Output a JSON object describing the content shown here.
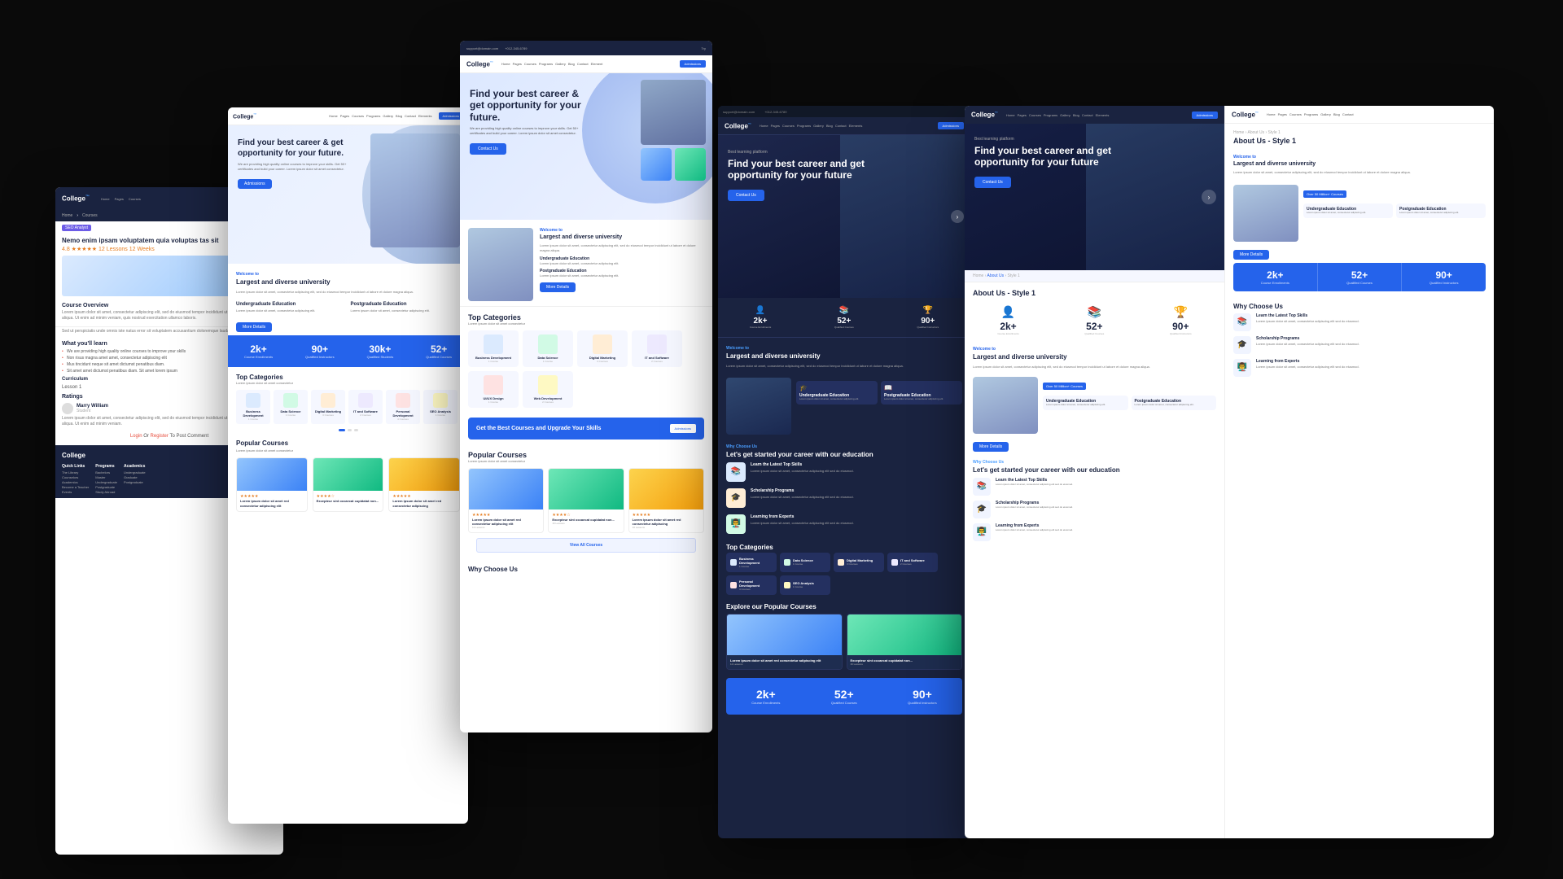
{
  "brand": {
    "name": "College",
    "sup": "™",
    "tagline": "Best learning platform"
  },
  "hero": {
    "title": "Find your best career & get opportunity for your future.",
    "title_dark": "Find your best career and get opportunity for your future",
    "subtitle": "We are providing high quality online courses to improve your skills. Get 50+ certificates and build your career. Lorem ipsum dolor sit amet consectetur.",
    "cta": "Admissions",
    "cta_contact": "Contact Us"
  },
  "nav": {
    "items": [
      "Home",
      "Pages",
      "Courses",
      "Programs",
      "Gallery",
      "Blog",
      "Contact",
      "Elements"
    ],
    "admission_btn": "Admissions"
  },
  "topbar": {
    "email": "support@domain.com",
    "phone": "+012-345-6789",
    "login": "Try"
  },
  "stats": [
    {
      "num": "2k+",
      "label": "Course Enrollments"
    },
    {
      "num": "90+",
      "label": "Qualified Instructors"
    },
    {
      "num": "30k+",
      "label": "Qualified Students"
    },
    {
      "num": "52+",
      "label": "Qualified Courses"
    }
  ],
  "welcome": {
    "label": "Welcome to",
    "title": "Largest and diverse university",
    "text": "Lorem ipsum dolor sit amet, consectetur adipiscing elit, sed do eiusmod tempor incididunt ut labore et dolore magna aliqua.",
    "undergraduate": {
      "title": "Undergraduate Education",
      "text": "Lorem ipsum dolor sit amet, consectetur adipiscing elit."
    },
    "postgraduate": {
      "title": "Postgraduate Education",
      "text": "Lorem ipsum dolor sit amet, consectetur adipiscing elit."
    },
    "more_btn": "More Details"
  },
  "categories": {
    "section_title": "Top Categories",
    "section_sub": "Lorem ipsum dolor sit amet consectetur",
    "items": [
      {
        "name": "Business Development",
        "count": "1 Course",
        "color": "blue"
      },
      {
        "name": "Data Science",
        "count": "1 Course",
        "color": "green"
      },
      {
        "name": "Digital Marketing",
        "count": "3 Courses",
        "color": "orange"
      },
      {
        "name": "IT and Software",
        "count": "2 Courses",
        "color": "purple"
      },
      {
        "name": "Personal Development",
        "count": "4 Courses",
        "color": "red"
      },
      {
        "name": "SEO Analysis",
        "count": "1 Course",
        "color": "yellow"
      }
    ]
  },
  "upgrade": {
    "text": "Get the Best Courses and Upgrade Your Skills",
    "btn": "Admissions"
  },
  "courses": {
    "section_title": "Popular Courses",
    "section_sub": "Lorem ipsum dolor sit amet consectetur",
    "items": [
      {
        "title": "Lorem ipsum dolor sit amet red consectetur adipiscing elit",
        "lessons": "12 Lessons",
        "students": "20 students",
        "color": "blue"
      },
      {
        "title": "Excepteur sint occaecat cupidatat non...",
        "lessons": "16 Lessons",
        "students": "18 students",
        "color": "green"
      },
      {
        "title": "Lorem ipsum dolor sit amet red consectetur adipiscing",
        "lessons": "10 Lessons",
        "students": "15 students",
        "color": "orange"
      }
    ],
    "view_all": "View All Courses"
  },
  "why": {
    "label": "Why Choose Us",
    "title": "Let's get started your career with our education",
    "items": [
      {
        "title": "Learn the Latest Top Skills",
        "text": "Lorem ipsum dolor sit amet, consectetur adipiscing elit sed do eiusmod.",
        "icon": "📚"
      },
      {
        "title": "Scholarship Programs",
        "text": "Lorem ipsum dolor sit amet, consectetur adipiscing elit sed do eiusmod.",
        "icon": "🎓"
      },
      {
        "title": "Learning from Experts",
        "text": "Lorem ipsum dolor sit amet, consectetur adipiscing elit sed do eiusmod.",
        "icon": "👨‍🏫"
      }
    ]
  },
  "about": {
    "breadcrumb": [
      "Home",
      "About Us",
      "Style 1"
    ],
    "title": "About Us - Style 1",
    "page_title": "About Us - Style 1"
  },
  "course_detail": {
    "badge": "SEO Analyst",
    "title": "Nemo enim ipsam voluptatem quia voluptas tas sit",
    "stars": "4.8 ★★★★★ 12 Lessons  12 Weeks",
    "overview_title": "Course Overview",
    "overview_text": "Lorem ipsum dolor sit amet, consectetur adipiscing elit, sed do eiusmod tempor incididunt ut labore et dolore magna aliqua. Ut enim ad minim veniam, quis nostrud exercitation ullamco laboris.",
    "learn_title": "What you'll learn",
    "learn_items": [
      "We are providing high quality online courses to improve your skills",
      "Non risus magna amet amet, consectetur adipiscing elit",
      "Mus tincidunt neque sit amet dictumst penatibus diam.",
      "Sit amet amet dictumst penatibus diam. Sit amet lorem ipsum"
    ],
    "curriculum_title": "Curriculum",
    "lesson_label": "Lesson 1",
    "ratings_title": "Ratings",
    "reviewer_name": "Marry William",
    "reviewer_role": "Student",
    "review_text": "Lorem ipsum dolor sit amet, consectetur adipiscing elit, sed do eiusmod tempor incididunt ut labore et dolore magna aliqua. Ut enim ad minim veniam.",
    "login_text": "Login Or Register To Post Comment",
    "login_link": "Login",
    "register_link": "Register"
  },
  "footer": {
    "quick_links": "Quick Links",
    "quick_items": [
      "The Library",
      "Counselors",
      "Academics",
      "Become a Teacher",
      "Events"
    ],
    "programs_title": "Programs",
    "programs_items": [
      "Bachelors",
      "Master",
      "Undergraduate",
      "Postgraduate",
      "Study Abroad"
    ],
    "academics_title": "Academics",
    "academics_items": [
      "Undergraduate",
      "Graduate",
      "Postgraduate"
    ]
  }
}
